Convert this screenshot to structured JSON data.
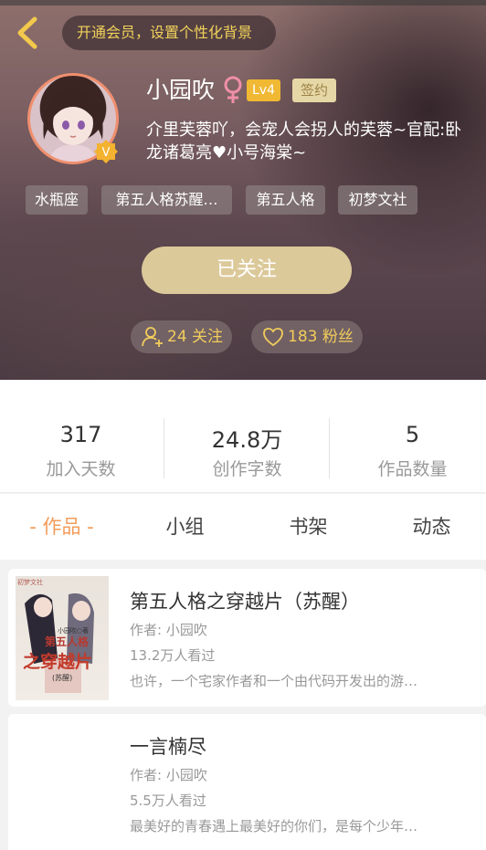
{
  "header": {
    "vip_banner": "开通会员，设置个性化背景",
    "username": "小园吹",
    "gender_symbol": "♀",
    "level": "Lv4",
    "signed": "签约",
    "bio": "介里芙蓉吖，会宠人会拐人的芙蓉~官配:卧龙诸葛亮♥小号海棠~",
    "tags": [
      "水瓶座",
      "第五人格苏醒…",
      "第五人格",
      "初梦文社"
    ],
    "follow_button": "已关注",
    "following": "24 关注",
    "followers": "183 粉丝",
    "avatar_badge": "V"
  },
  "stats": [
    {
      "value": "317",
      "label": "加入天数"
    },
    {
      "value": "24.8万",
      "label": "创作字数"
    },
    {
      "value": "5",
      "label": "作品数量"
    }
  ],
  "tabs": [
    "- 作品 -",
    "小组",
    "书架",
    "动态"
  ],
  "works": [
    {
      "title": "第五人格之穿越片（苏醒）",
      "author": "作者: 小园吹",
      "views": "13.2万人看过",
      "desc": "也许，一个宅家作者和一个由代码开发出的游…",
      "cover": {
        "publisher": "初梦文社",
        "byline": "小园吹○著",
        "title_top": "第五人格",
        "title_main": "之穿越片",
        "subtitle": "(苏醒)"
      }
    },
    {
      "title": "一言楠尽",
      "author": "作者: 小园吹",
      "views": "5.5万人看过",
      "desc": "最美好的青春遇上最美好的你们，是每个少年…"
    }
  ],
  "colors": {
    "accent_orange": "#f39b5a",
    "gold_text": "#f1d25b",
    "follow_button": "#dcc99a",
    "level_badge": "#f0b833"
  }
}
